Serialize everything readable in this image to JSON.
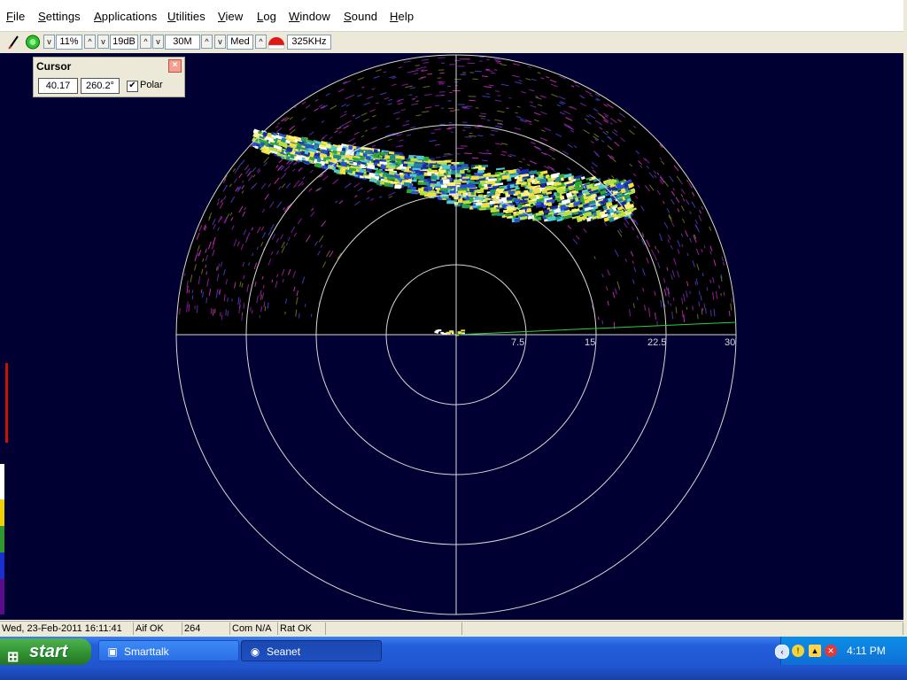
{
  "menu": [
    "File",
    "Settings",
    "Applications",
    "Utilities",
    "View",
    "Log",
    "Window",
    "Sound",
    "Help"
  ],
  "toolbar": {
    "gain": "11%",
    "contrast": "19dB",
    "range": "30M",
    "speed": "Med",
    "frequency": "325KHz",
    "up_arrow": "^",
    "down_arrow": "v"
  },
  "cursor_panel": {
    "title": "Cursor",
    "close_glyph": "×",
    "range_value": "40.17",
    "bearing_value": "260.2°",
    "polar_checked": true,
    "polar_check_glyph": "✔",
    "polar_label": "Polar"
  },
  "sonar": {
    "range_labels": [
      "7.5",
      "15",
      "22.5",
      "30"
    ],
    "background_color": "#000033",
    "grid_color": "#d8d8d8",
    "heading_line_color": "#2ecc40"
  },
  "status": {
    "datetime": "Wed, 23-Feb-2011 16:11:41",
    "aif": "Aif OK",
    "count": "264",
    "com": "Com N/A",
    "rat": "Rat OK"
  },
  "taskbar": {
    "start_label": "start",
    "start_logo": "⊞",
    "tasks": [
      {
        "label": "Smarttalk",
        "icon": "smarttalk-icon",
        "glyph": "▣"
      },
      {
        "label": "Seanet",
        "icon": "seanet-icon",
        "glyph": "◉"
      }
    ],
    "tray_glyphs": [
      "‹",
      "!",
      "▲",
      "✕"
    ],
    "clock": "4:11 PM"
  }
}
